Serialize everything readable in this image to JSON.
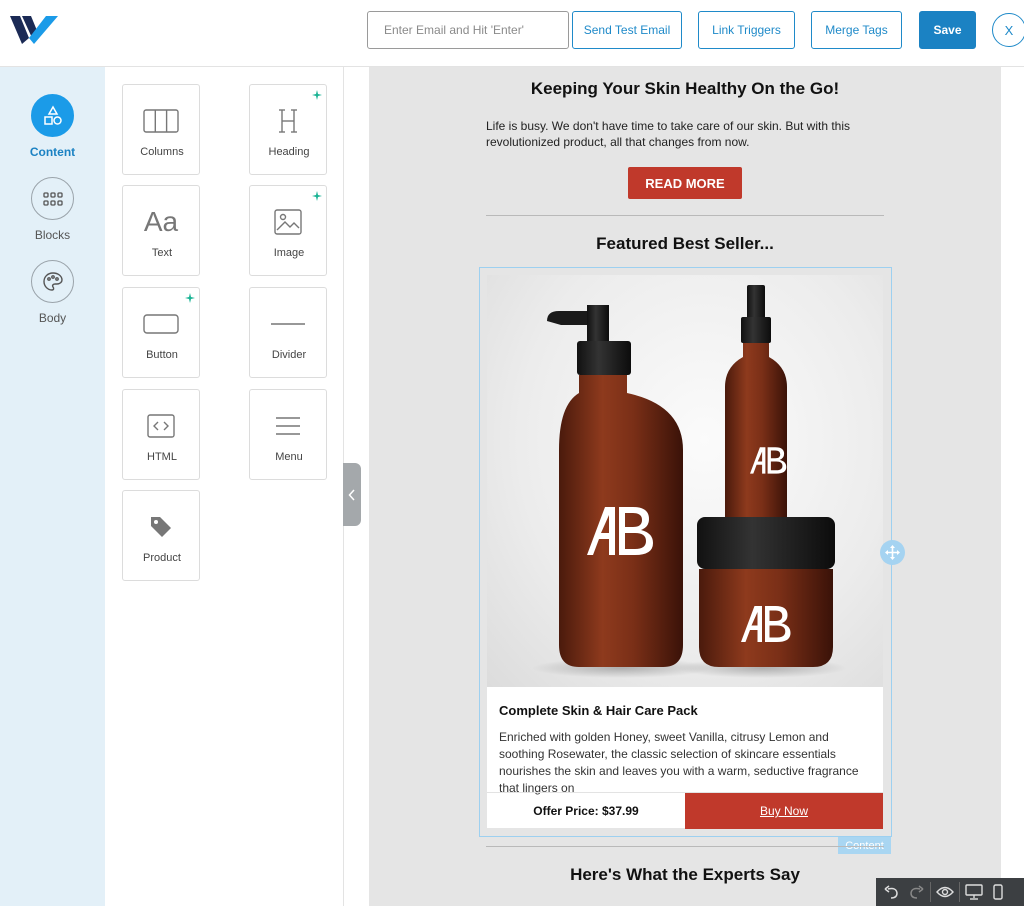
{
  "header": {
    "email_placeholder": "Enter Email and Hit 'Enter'",
    "send_test_label": "Send Test Email",
    "link_triggers_label": "Link Triggers",
    "merge_tags_label": "Merge Tags",
    "save_label": "Save",
    "close_label": "X"
  },
  "nav": {
    "items": [
      {
        "label": "Content",
        "icon": "shapes-icon",
        "active": true
      },
      {
        "label": "Blocks",
        "icon": "grid-icon",
        "active": false
      },
      {
        "label": "Body",
        "icon": "palette-icon",
        "active": false
      }
    ]
  },
  "tools": {
    "items": [
      {
        "label": "Columns",
        "icon": "columns-icon"
      },
      {
        "label": "Heading",
        "icon": "heading-icon",
        "ai": true
      },
      {
        "label": "Text",
        "icon": "text-icon",
        "glyph": "Aa"
      },
      {
        "label": "Image",
        "icon": "image-icon",
        "ai": true
      },
      {
        "label": "Button",
        "icon": "button-icon",
        "ai": true
      },
      {
        "label": "Divider",
        "icon": "divider-icon"
      },
      {
        "label": "HTML",
        "icon": "html-icon"
      },
      {
        "label": "Menu",
        "icon": "menu-icon"
      },
      {
        "label": "Product",
        "icon": "tag-icon"
      }
    ]
  },
  "email": {
    "heading1": "Keeping Your Skin Healthy On the Go!",
    "paragraph1": "Life is busy. We don't have time to take care of our skin. But with this revolutionized product, all that changes from now.",
    "read_more_label": "READ MORE",
    "heading2": "Featured Best Seller...",
    "product": {
      "title": "Complete Skin & Hair Care Pack",
      "description": "Enriched with golden Honey, sweet Vanilla, citrusy Lemon and soothing Rosewater, the classic selection of skincare essentials nourishes the skin and leaves you with a warm, seductive fragrance that lingers on",
      "offer_price": "Offer Price: $37.99",
      "buy_label": "Buy Now",
      "logo_text": "AB"
    },
    "selected_block_tag": "Content",
    "heading3": "Here's What the Experts Say"
  },
  "colors": {
    "primary": "#1b82c3",
    "accent_red": "#c0392b",
    "nav_bg": "#e3f0f8",
    "canvas_bg": "#e5e5e5"
  }
}
